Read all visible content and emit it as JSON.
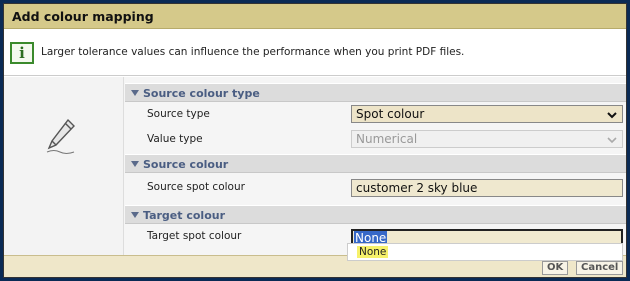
{
  "dialog": {
    "title": "Add colour mapping",
    "info_text": "Larger tolerance values can influence the performance when you print PDF files."
  },
  "icons": {
    "info": "info-icon",
    "pencil": "pencil-icon",
    "info_glyph": "i"
  },
  "sections": {
    "source_colour_type": {
      "title": "Source colour type",
      "source_type_label": "Source type",
      "source_type_value": "Spot colour",
      "value_type_label": "Value type",
      "value_type_value": "Numerical"
    },
    "source_colour": {
      "title": "Source colour",
      "source_spot_label": "Source spot colour",
      "source_spot_value": "customer 2 sky blue"
    },
    "target_colour": {
      "title": "Target colour",
      "target_spot_label": "Target spot colour",
      "target_spot_value": "None",
      "dropdown_option": "None"
    }
  },
  "footer": {
    "ok_label": "OK",
    "cancel_label": "Cancel"
  },
  "colors": {
    "titlebar": "#d5c98a",
    "section_header": "#dcdcdc",
    "section_label": "#4a5d82",
    "field_bg": "#ede4c8",
    "selection": "#3668c8",
    "option_highlight": "#f6f16a"
  }
}
